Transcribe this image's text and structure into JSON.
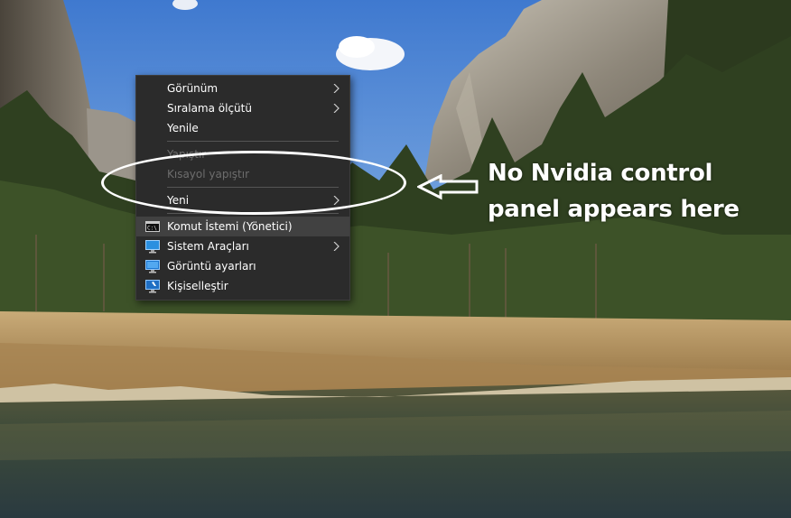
{
  "desktop": {
    "wallpaper": "yosemite-valley-landscape"
  },
  "context_menu": {
    "items": [
      {
        "label": "Görünüm",
        "enabled": true,
        "submenu": true
      },
      {
        "label": "Sıralama ölçütü",
        "enabled": true,
        "submenu": true
      },
      {
        "label": "Yenile",
        "enabled": true,
        "submenu": false
      },
      {
        "label": "Yapıştır",
        "enabled": false,
        "submenu": false
      },
      {
        "label": "Kısayol yapıştır",
        "enabled": false,
        "submenu": false
      },
      {
        "label": "Yeni",
        "enabled": true,
        "submenu": true
      },
      {
        "label": "Komut İstemi (Yönetici)",
        "enabled": true,
        "submenu": false,
        "icon": "command-prompt-icon",
        "highlighted": true
      },
      {
        "label": "Sistem Araçları",
        "enabled": true,
        "submenu": true,
        "icon": "monitor-icon"
      },
      {
        "label": "Görüntü ayarları",
        "enabled": true,
        "submenu": false,
        "icon": "display-settings-icon"
      },
      {
        "label": "Kişiselleştir",
        "enabled": true,
        "submenu": false,
        "icon": "personalize-icon"
      }
    ],
    "colors": {
      "background": "#2b2b2b",
      "text": "#ffffff",
      "disabled_text": "#6d6d6d",
      "highlight": "#414141"
    }
  },
  "annotation": {
    "text": "No Nvidia control panel appears here",
    "color": "#ffffff"
  }
}
